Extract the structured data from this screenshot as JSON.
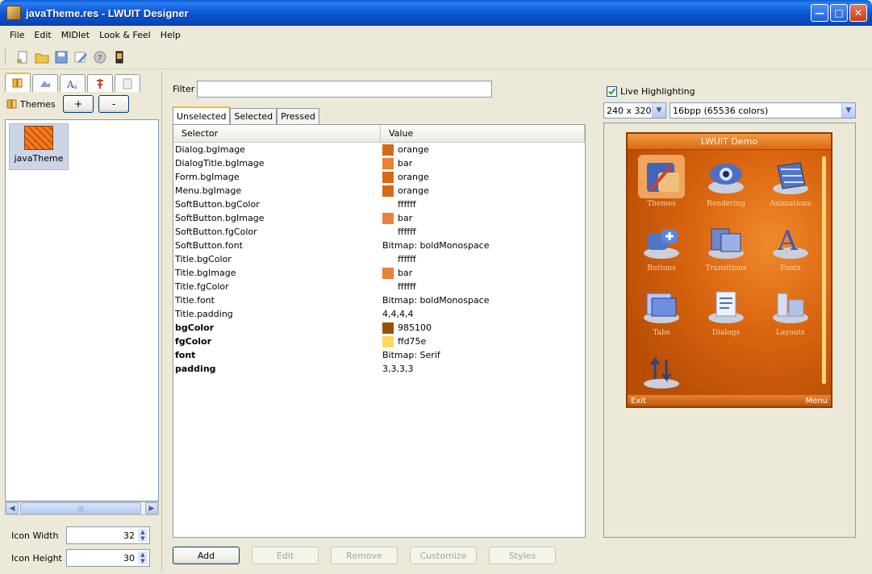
{
  "window": {
    "title": "javaTheme.res - LWUIT Designer"
  },
  "menu": [
    "File",
    "Edit",
    "MIDlet",
    "Look & Feel",
    "Help"
  ],
  "toolbar": {
    "icons": [
      "new-icon",
      "open-icon",
      "save-icon",
      "edit-icon",
      "help-icon",
      "preview-icon"
    ]
  },
  "left": {
    "tabs": [
      "themes-tab-icon",
      "images-tab-icon",
      "fonts-tab-icon",
      "localization-tab-icon",
      "data-tab-icon"
    ],
    "themes_label": "Themes",
    "add_label": "+",
    "remove_label": "-",
    "themes": [
      {
        "name": "javaTheme"
      }
    ],
    "icon_width_label": "Icon Width",
    "icon_width": "32",
    "icon_height_label": "Icon Height",
    "icon_height": "30"
  },
  "filter": {
    "label": "Filter",
    "value": ""
  },
  "tabs": [
    "Unselected",
    "Selected",
    "Pressed"
  ],
  "table": {
    "headers": [
      "Selector",
      "Value"
    ],
    "rows": [
      {
        "selector": "Dialog.bgImage",
        "value": "orange",
        "swatch": "#d86a17",
        "bold": false
      },
      {
        "selector": "DialogTitle.bgImage",
        "value": "bar",
        "swatch": "#e8823a",
        "bold": false
      },
      {
        "selector": "Form.bgImage",
        "value": "orange",
        "swatch": "#d86a17",
        "bold": false
      },
      {
        "selector": "Menu.bgImage",
        "value": "orange",
        "swatch": "#d86a17",
        "bold": false
      },
      {
        "selector": "SoftButton.bgColor",
        "value": "ffffff",
        "swatch": "#ffffff",
        "bold": false
      },
      {
        "selector": "SoftButton.bgImage",
        "value": "bar",
        "swatch": "#e8823a",
        "bold": false
      },
      {
        "selector": "SoftButton.fgColor",
        "value": "ffffff",
        "swatch": "#ffffff",
        "bold": false
      },
      {
        "selector": "SoftButton.font",
        "value": "Bitmap: boldMonospace",
        "swatch": "",
        "bold": false
      },
      {
        "selector": "Title.bgColor",
        "value": "ffffff",
        "swatch": "#ffffff",
        "bold": false
      },
      {
        "selector": "Title.bgImage",
        "value": "bar",
        "swatch": "#e8823a",
        "bold": false
      },
      {
        "selector": "Title.fgColor",
        "value": "ffffff",
        "swatch": "#ffffff",
        "bold": false
      },
      {
        "selector": "Title.font",
        "value": "Bitmap: boldMonospace",
        "swatch": "",
        "bold": false
      },
      {
        "selector": "Title.padding",
        "value": "4,4,4,4",
        "swatch": "",
        "bold": false
      },
      {
        "selector": "bgColor",
        "value": "985100",
        "swatch": "#985100",
        "bold": true
      },
      {
        "selector": "fgColor",
        "value": "ffd75e",
        "swatch": "#ffd75e",
        "bold": true
      },
      {
        "selector": "font",
        "value": "Bitmap: Serif",
        "swatch": "",
        "bold": true
      },
      {
        "selector": "padding",
        "value": "3,3,3,3",
        "swatch": "",
        "bold": true
      }
    ]
  },
  "buttons": {
    "add": "Add",
    "edit": "Edit",
    "remove": "Remove",
    "customize": "Customize",
    "styles": "Styles"
  },
  "preview": {
    "live_highlighting_label": "Live Highlighting",
    "live_highlighting_checked": true,
    "resolution": "240 x 320",
    "color_depth": "16bpp (65536 colors)",
    "phone": {
      "title": "LWUIT Demo",
      "items": [
        {
          "label": "Themes",
          "icon": "themes-icon"
        },
        {
          "label": "Rendering",
          "icon": "rendering-icon"
        },
        {
          "label": "Animations",
          "icon": "animations-icon"
        },
        {
          "label": "Buttons",
          "icon": "buttons-icon"
        },
        {
          "label": "Transitions",
          "icon": "transitions-icon"
        },
        {
          "label": "Fonts",
          "icon": "fonts-icon"
        },
        {
          "label": "Tabs",
          "icon": "tabs-icon"
        },
        {
          "label": "Dialogs",
          "icon": "dialogs-icon"
        },
        {
          "label": "Layouts",
          "icon": "layouts-icon"
        },
        {
          "label": "",
          "icon": "scroll-icon"
        }
      ],
      "left_soft": "Exit",
      "right_soft": "Menu"
    }
  },
  "colors": {
    "accent": "#0b56d4",
    "theme_orange": "#d15f0b"
  }
}
